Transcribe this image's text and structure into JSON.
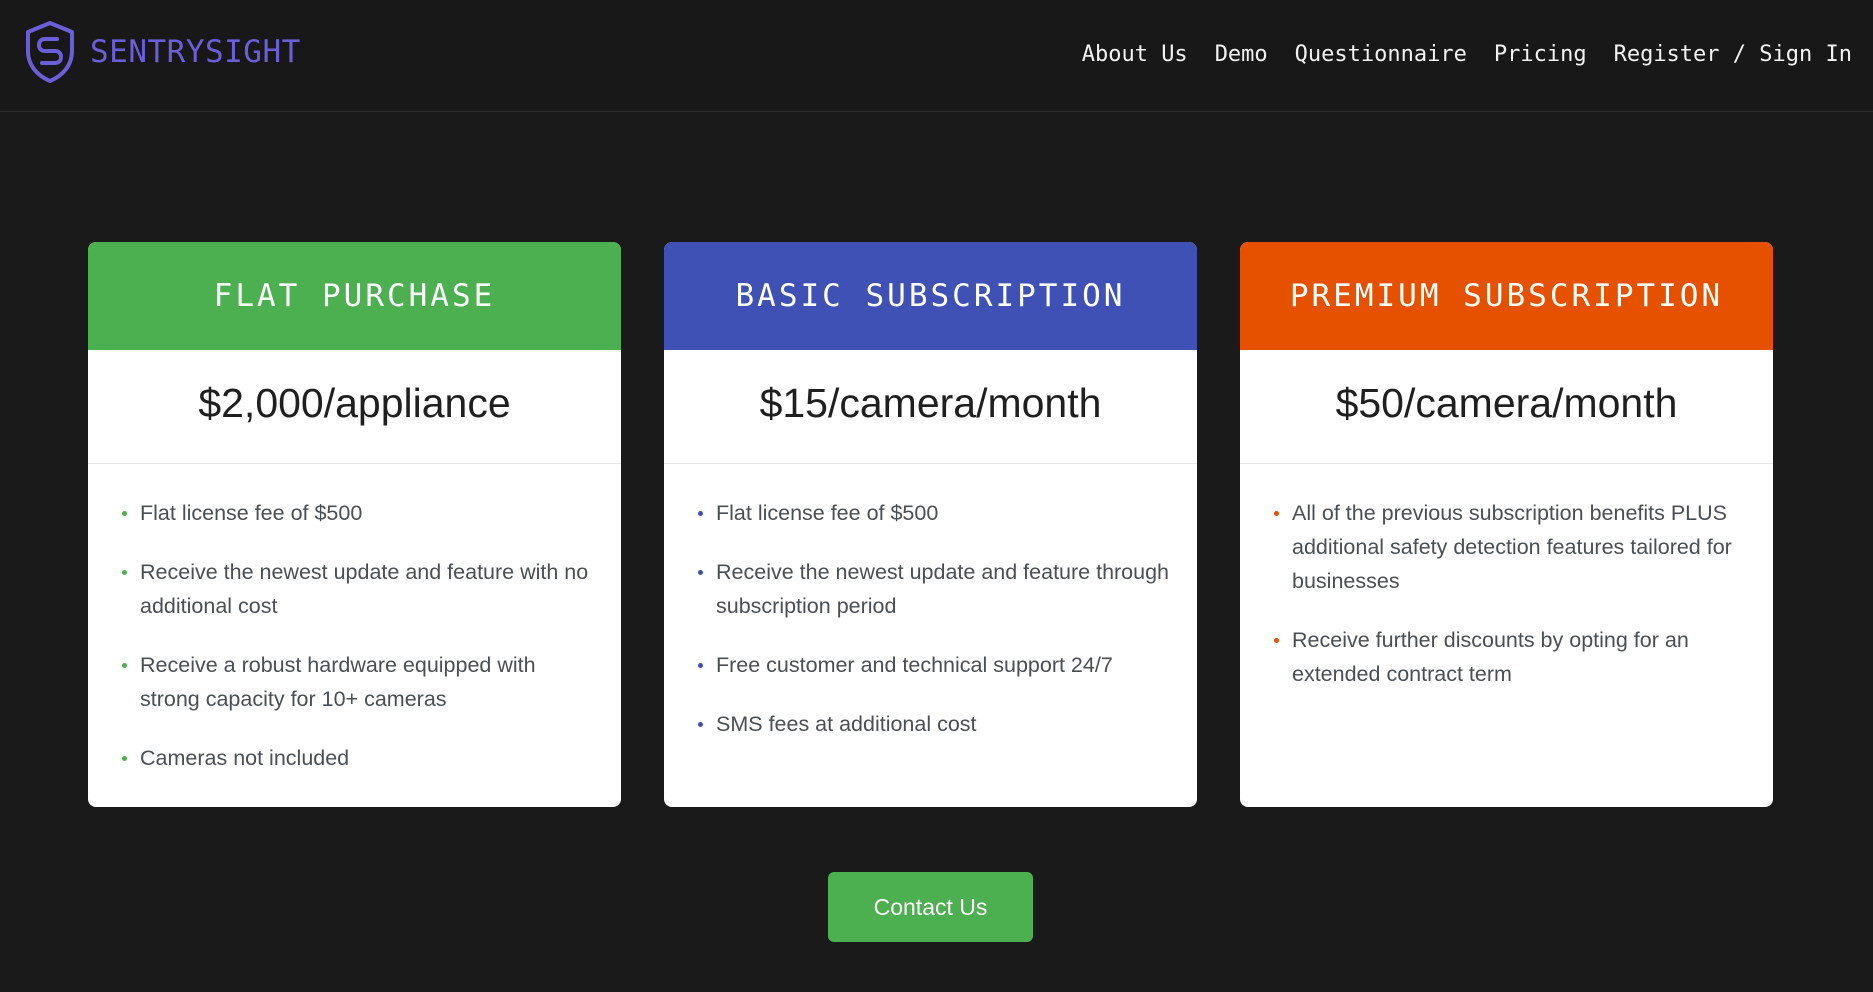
{
  "brand": {
    "name": "SENTRYSIGHT",
    "logo_icon": "shield-s-icon",
    "color": "#6a5fd8"
  },
  "nav": {
    "items": [
      {
        "label": "About Us"
      },
      {
        "label": "Demo"
      },
      {
        "label": "Questionnaire"
      },
      {
        "label": "Pricing"
      },
      {
        "label": "Register / Sign In"
      }
    ]
  },
  "plans": [
    {
      "title": "FLAT PURCHASE",
      "price": "$2,000/appliance",
      "color": "#4caf50",
      "features": [
        "Flat license fee of $500",
        "Receive the newest update and feature with no additional cost",
        "Receive a robust hardware equipped with strong capacity for 10+ cameras",
        "Cameras not included"
      ]
    },
    {
      "title": "BASIC SUBSCRIPTION",
      "price": "$15/camera/month",
      "color": "#3f51b5",
      "features": [
        "Flat license fee of $500",
        "Receive the newest update and feature through subscription period",
        "Free customer and technical support 24/7",
        "SMS fees at additional cost"
      ]
    },
    {
      "title": "PREMIUM SUBSCRIPTION",
      "price": "$50/camera/month",
      "color": "#e65100",
      "features": [
        "All of the previous subscription benefits PLUS additional safety detection features tailored for businesses",
        "Receive further discounts by opting for an extended contract term"
      ]
    }
  ],
  "contact": {
    "label": "Contact Us",
    "color": "#4caf50"
  },
  "colors": {
    "page_background": "#1a1a1a",
    "navbar_background": "#181818",
    "card_background": "#ffffff"
  }
}
